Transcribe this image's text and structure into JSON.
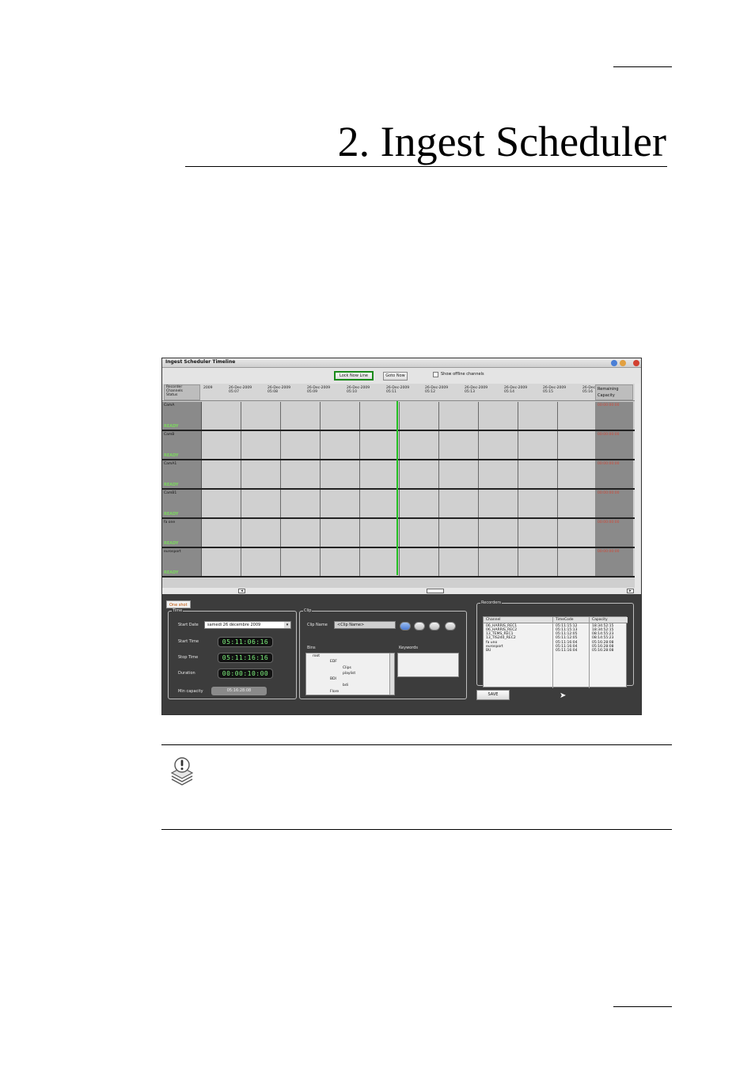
{
  "chapter": {
    "title": "2.  Ingest Scheduler"
  },
  "screenshot": {
    "window_title": "Ingest Scheduler Timeline",
    "toolbar": {
      "lock_label": "Lock Now Line",
      "goto_label": "Goto Now",
      "offline_label": "Show offline channels"
    },
    "timeline": {
      "left_header": [
        "Recorder",
        "Channels",
        "Status"
      ],
      "right_header": [
        "Remaining",
        "Capacity"
      ],
      "ticks": [
        {
          "date": "2009",
          "time": ""
        },
        {
          "date": "26-Dec-2009",
          "time": "05:07"
        },
        {
          "date": "26-Dec-2009",
          "time": "05:08"
        },
        {
          "date": "26-Dec-2009",
          "time": "05:09"
        },
        {
          "date": "26-Dec-2009",
          "time": "05:10"
        },
        {
          "date": "26-Dec-2009",
          "time": "05:11"
        },
        {
          "date": "26-Dec-2009",
          "time": "05:12"
        },
        {
          "date": "26-Dec-2009",
          "time": "05:13"
        },
        {
          "date": "26-Dec-2009",
          "time": "05:14"
        },
        {
          "date": "26-Dec-2009",
          "time": "05:15"
        },
        {
          "date": "26-Dec",
          "time": "05:16"
        }
      ],
      "channels": [
        {
          "name": "CamA",
          "status": "READY",
          "capacity": "00:00:00:00"
        },
        {
          "name": "CamB",
          "status": "READY",
          "capacity": "00:00:00:00"
        },
        {
          "name": "CamA1",
          "status": "READY",
          "capacity": "00:00:00:00"
        },
        {
          "name": "CamB1",
          "status": "READY",
          "capacity": "00:00:00:00"
        },
        {
          "name": "fa one",
          "status": "READY",
          "capacity": "00:00:00:00"
        },
        {
          "name": "eurosport",
          "status": "READY",
          "capacity": "00:00:00:00"
        }
      ]
    },
    "panel": {
      "tab": "One shot",
      "time_group": "Time",
      "start_date_label": "Start Date",
      "start_date_value": "samedi   26 décembre 2009",
      "start_time_label": "Start Time",
      "start_time_value": "05:11:06:16",
      "stop_time_label": "Stop Time",
      "stop_time_value": "05:11:16:16",
      "duration_label": "Duration",
      "duration_value": "00:00:10:00",
      "min_capacity_label": "Min capacity",
      "min_capacity_value": "05:16:28:08",
      "clip_group": "Clip",
      "clip_name_label": "Clip Name",
      "clip_name_value": "<Clip Name>",
      "bins_label": "Bins",
      "keywords_label": "Keywords",
      "tree": [
        "root",
        "EDF",
        "Clips",
        "playlist",
        "BDI",
        "bdi",
        "Flore"
      ],
      "recorders_group": "Recorders",
      "recorders_columns": [
        "Channel",
        "TimeCode",
        "Capacity"
      ],
      "recorders_rows": [
        [
          "06_HARRIS_REC1",
          "05:11:15:12",
          "18:34:52:15"
        ],
        [
          "06_HARRIS_REC2",
          "05:11:15:13",
          "18:34:52:15"
        ],
        [
          "13_TEMS_REC1",
          "05:11:12:05",
          "08:14:55:23"
        ],
        [
          "13_TIS240_REC2",
          "05:11:12:05",
          "08:14:55:23"
        ],
        [
          "fa uno",
          "05:11:16:04",
          "05:16:28:08"
        ],
        [
          "eurosport",
          "05:11:16:04",
          "05:16:28:08"
        ],
        [
          "BU",
          "05:11:16:04",
          "05:16:28:08"
        ]
      ],
      "save_label": "SAVE"
    }
  }
}
